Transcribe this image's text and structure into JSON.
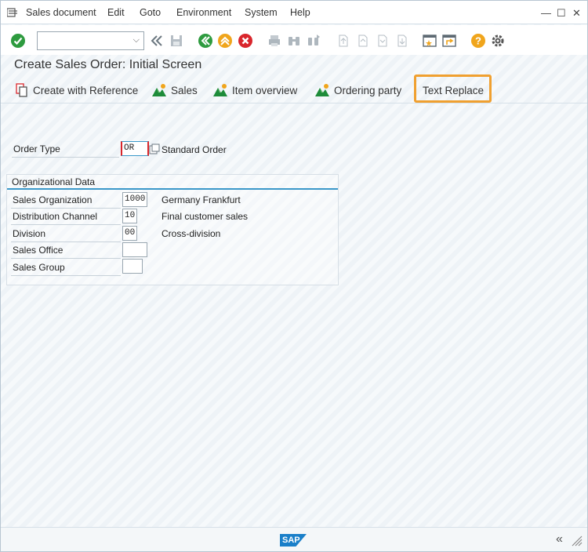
{
  "menu": {
    "items": [
      "Sales document",
      "Edit",
      "Goto",
      "Environment",
      "System",
      "Help"
    ]
  },
  "window_controls": {
    "minimize": "—",
    "maximize": "☐",
    "close": "✕"
  },
  "toolbar": {
    "command_value": ""
  },
  "title": "Create Sales Order: Initial Screen",
  "app_toolbar": {
    "create_ref": "Create with Reference",
    "sales": "Sales",
    "item_overview": "Item overview",
    "ordering_party": "Ordering party",
    "text_replace": "Text Replace"
  },
  "order_type": {
    "label": "Order Type",
    "value": "OR",
    "description": "Standard Order"
  },
  "org_data": {
    "title": "Organizational Data",
    "rows": [
      {
        "label": "Sales Organization",
        "value": "1000",
        "description": "Germany Frankfurt"
      },
      {
        "label": "Distribution Channel",
        "value": "10",
        "description": "Final customer sales"
      },
      {
        "label": "Division",
        "value": "00",
        "description": "Cross-division"
      },
      {
        "label": "Sales Office",
        "value": "",
        "description": ""
      },
      {
        "label": "Sales Group",
        "value": "",
        "description": ""
      }
    ]
  },
  "footer": {
    "logo": "SAP"
  },
  "colors": {
    "accent": "#3a98c9",
    "highlight": "#f0a030",
    "brand": "#1a7fc9"
  }
}
